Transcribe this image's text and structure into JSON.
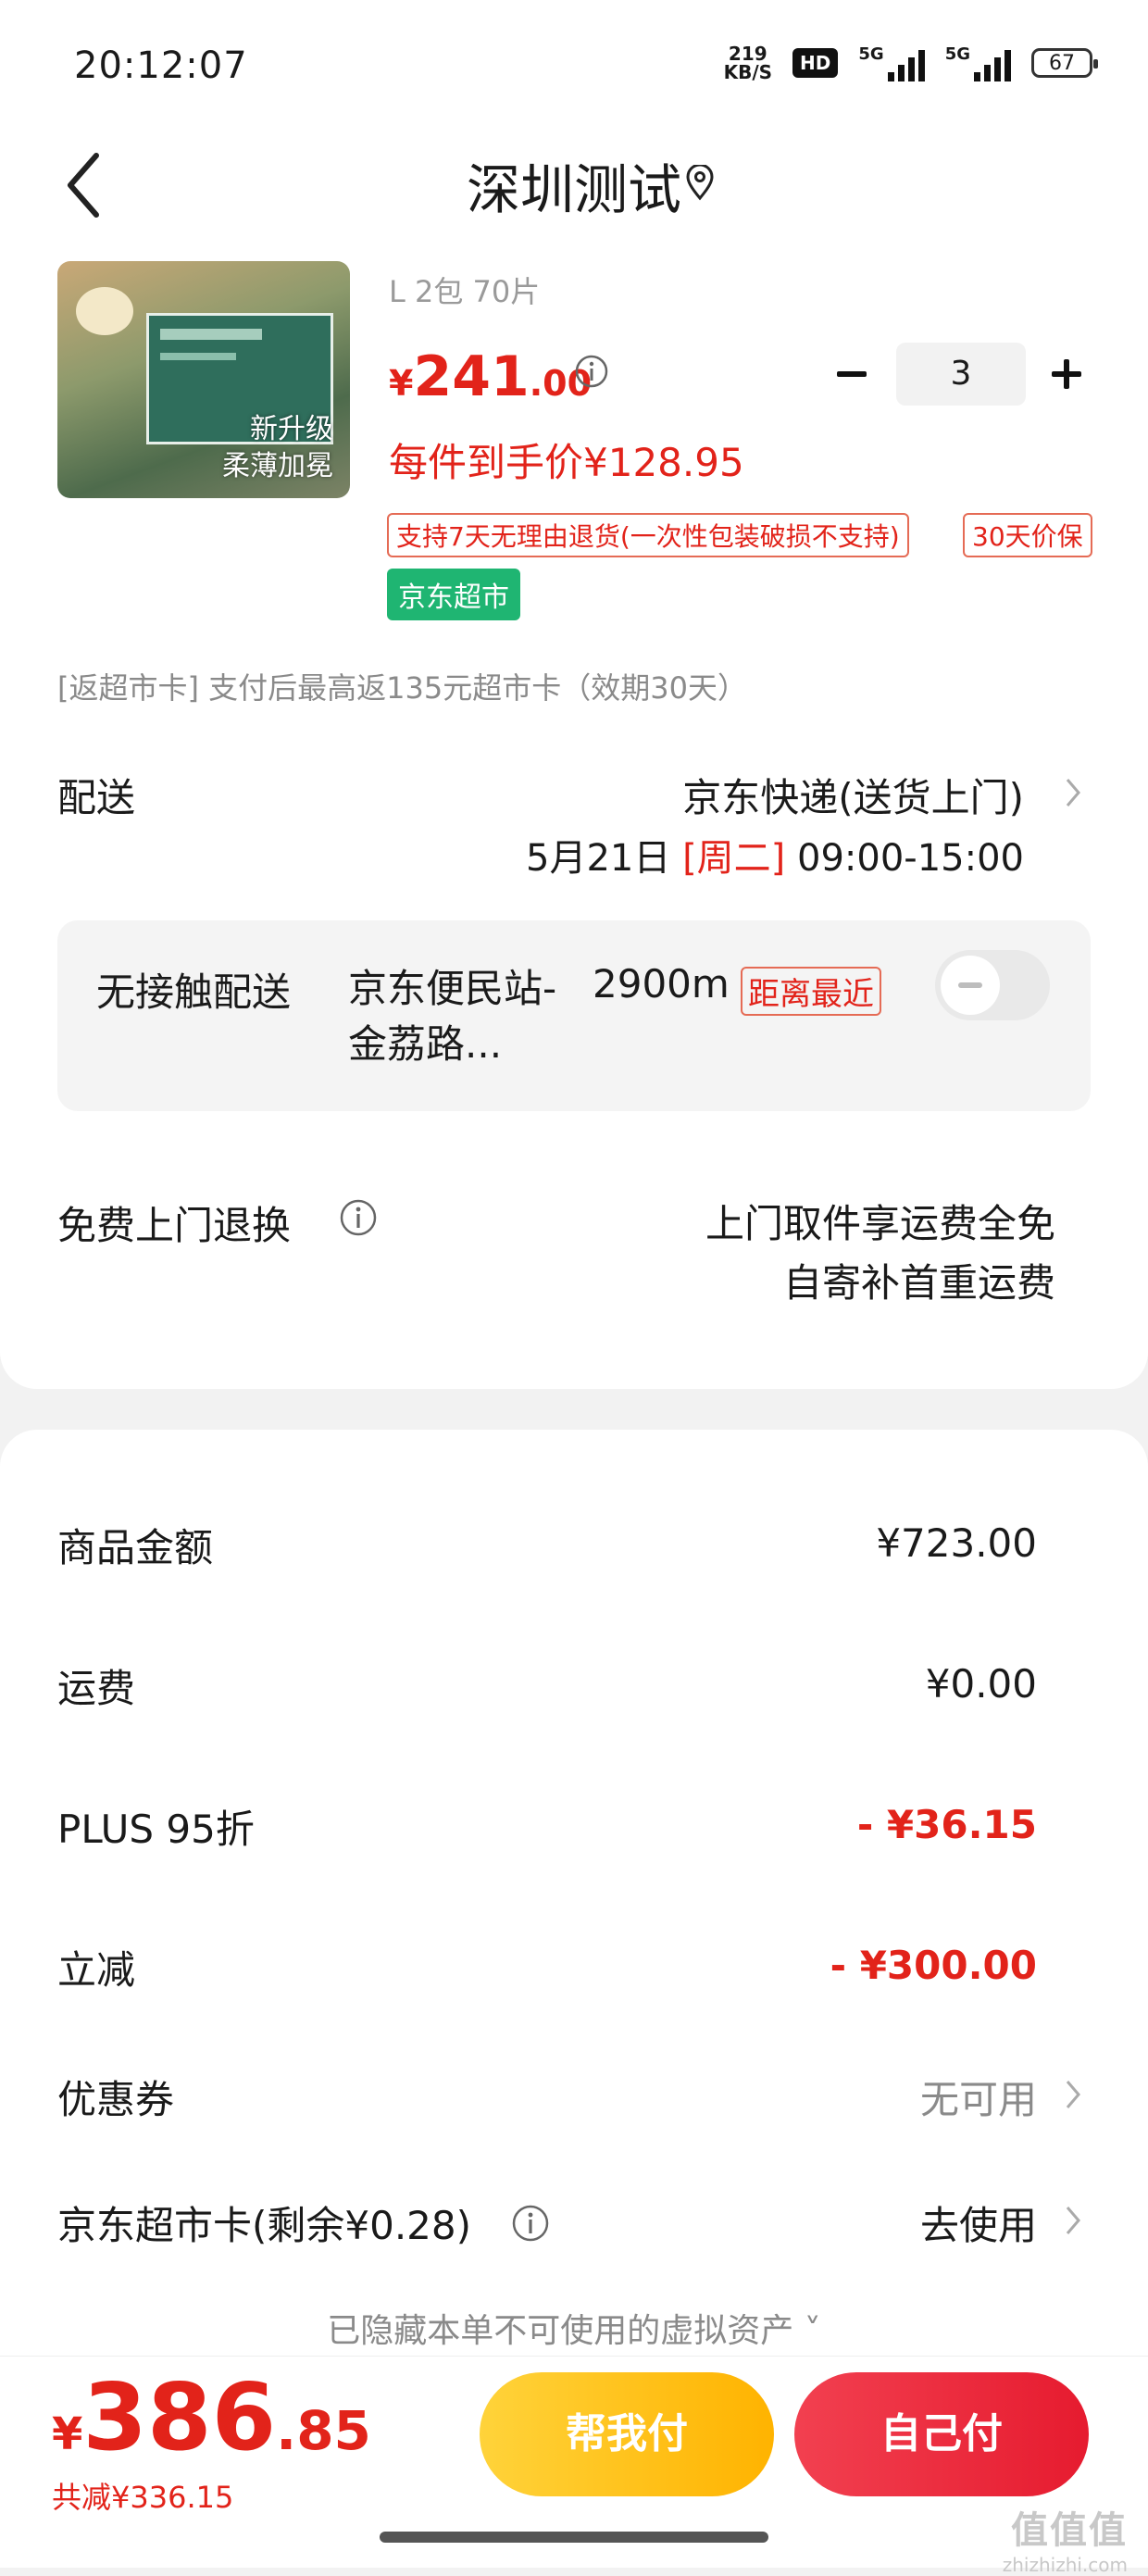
{
  "status_bar": {
    "time": "20:12:07",
    "net_speed_value": "219",
    "net_speed_unit": "KB/S",
    "hd_label": "HD",
    "sig1_label": "5G",
    "sig2_label": "5G",
    "battery": "67"
  },
  "header": {
    "title": "深圳测试"
  },
  "product": {
    "thumb_text_1": "新升级",
    "thumb_text_2": "柔薄加冕",
    "spec": "L 2包 70片",
    "price_symbol": "¥",
    "price_int": "241",
    "price_dec": ".00",
    "quantity": "3",
    "unit_price": "每件到手价¥128.95",
    "badge_return": "支持7天无理由退货(一次性包装破损不支持)",
    "badge_protect": "30天价保",
    "market_tag": "京东超市"
  },
  "rebate": "[返超市卡]   支付后最高返135元超市卡（效期30天）",
  "delivery": {
    "label": "配送",
    "method": "京东快递(送货上门)",
    "date": "5月21日 ",
    "weekday": "[周二]",
    "time": " 09:00-15:00"
  },
  "contactless": {
    "title": "无接触配送",
    "station": "京东便民站-金荔路...",
    "distance": "2900m",
    "tag": "距离最近"
  },
  "return_service": {
    "label": "免费上门退换",
    "line1": "上门取件享运费全免",
    "line2": "自寄补首重运费"
  },
  "summary": {
    "goods_label": "商品金额",
    "goods_value": "¥723.00",
    "shipping_label": "运费",
    "shipping_value": "¥0.00",
    "plus_label": "PLUS 95折",
    "plus_value": "- ¥36.15",
    "instant_label": "立减",
    "instant_value": "- ¥300.00",
    "coupon_label": "优惠券",
    "coupon_value": "无可用",
    "card_label": "京东超市卡(剩余¥0.28)",
    "card_value": "去使用",
    "hidden_assets": "已隐藏本单不可使用的虚拟资产 ˅"
  },
  "footer": {
    "total_symbol": "¥",
    "total_int": "386",
    "total_dec": ".85",
    "total_discount": "共减¥336.15",
    "help_pay": "帮我付",
    "self_pay": "自己付"
  },
  "watermark": {
    "logo": "值值值",
    "url": "zhizhizhi.com"
  },
  "colors": {
    "accent_red": "#e2231a",
    "market_green": "#1fb572",
    "help_yellow": "#ffc21a"
  }
}
